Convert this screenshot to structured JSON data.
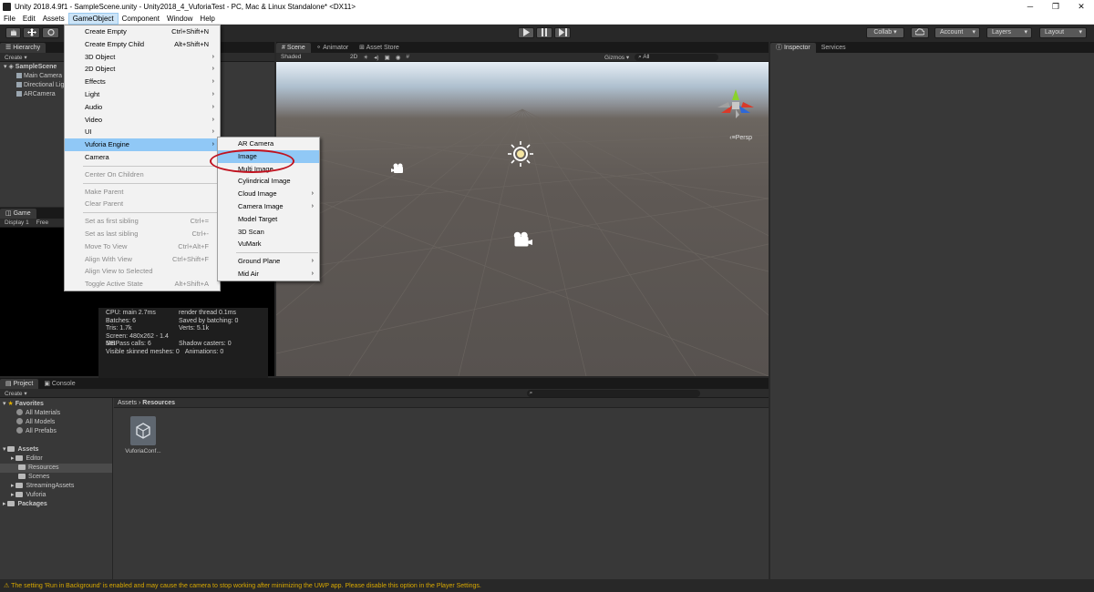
{
  "window": {
    "title": "Unity 2018.4.9f1 - SampleScene.unity - Unity2018_4_VuforiaTest - PC, Mac & Linux Standalone* <DX11>",
    "controls": [
      "─",
      "❐",
      "✕"
    ]
  },
  "menubar": [
    "File",
    "Edit",
    "Assets",
    "GameObject",
    "Component",
    "Window",
    "Help"
  ],
  "toolbar": {
    "collab": "Collab ▾",
    "account": "Account",
    "layers": "Layers",
    "layout": "Layout"
  },
  "hierarchy": {
    "tab": "Hierarchy",
    "create": "Create ▾",
    "scene": "SampleScene",
    "items": [
      "Main Camera",
      "Directional Light",
      "ARCamera"
    ]
  },
  "game": {
    "tab": "Game",
    "display": "Display 1",
    "free": "Free",
    "stats": [
      [
        "CPU: main 2.7ms",
        "render thread 0.1ms"
      ],
      [
        "Batches: 6",
        "Saved by batching: 0"
      ],
      [
        "Tris: 1.7k",
        "Verts: 5.1k"
      ],
      [
        "Screen: 480x262 - 1.4 MB",
        ""
      ],
      [
        "SetPass calls: 6",
        "Shadow casters: 0"
      ],
      [
        "Visible skinned meshes: 0",
        "Animations: 0"
      ]
    ]
  },
  "scene": {
    "tabs": [
      "Scene",
      "Animator",
      "Asset Store"
    ],
    "shaded": "Shaded",
    "mode2d": "2D",
    "gizmos": "Gizmos ▾",
    "search": "All",
    "persp": "Persp"
  },
  "inspector": {
    "tabs": [
      "Inspector",
      "Services"
    ]
  },
  "project": {
    "tabs": [
      "Project",
      "Console"
    ],
    "create": "Create ▾",
    "favorites": "Favorites",
    "fav_items": [
      "All Materials",
      "All Models",
      "All Prefabs"
    ],
    "assets": "Assets",
    "asset_items": [
      "Editor",
      "Resources",
      "Scenes",
      "StreamingAssets",
      "Vuforia"
    ],
    "packages": "Packages",
    "breadcrumb": [
      "Assets",
      "Resources"
    ],
    "file": "VuforiaConf..."
  },
  "gameobject_menu": [
    {
      "label": "Create Empty",
      "shortcut": "Ctrl+Shift+N"
    },
    {
      "label": "Create Empty Child",
      "shortcut": "Alt+Shift+N"
    },
    {
      "label": "3D Object",
      "submenu": true
    },
    {
      "label": "2D Object",
      "submenu": true
    },
    {
      "label": "Effects",
      "submenu": true
    },
    {
      "label": "Light",
      "submenu": true
    },
    {
      "label": "Audio",
      "submenu": true
    },
    {
      "label": "Video",
      "submenu": true
    },
    {
      "label": "UI",
      "submenu": true
    },
    {
      "label": "Vuforia Engine",
      "submenu": true,
      "highlighted": true
    },
    {
      "label": "Camera"
    },
    {
      "sep": true
    },
    {
      "label": "Center On Children",
      "disabled": true
    },
    {
      "sep": true
    },
    {
      "label": "Make Parent",
      "disabled": true
    },
    {
      "label": "Clear Parent",
      "disabled": true
    },
    {
      "sep": true
    },
    {
      "label": "Set as first sibling",
      "shortcut": "Ctrl+=",
      "disabled": true
    },
    {
      "label": "Set as last sibling",
      "shortcut": "Ctrl+-",
      "disabled": true
    },
    {
      "label": "Move To View",
      "shortcut": "Ctrl+Alt+F",
      "disabled": true
    },
    {
      "label": "Align With View",
      "shortcut": "Ctrl+Shift+F",
      "disabled": true
    },
    {
      "label": "Align View to Selected",
      "disabled": true
    },
    {
      "label": "Toggle Active State",
      "shortcut": "Alt+Shift+A",
      "disabled": true
    }
  ],
  "vuforia_menu": [
    {
      "label": "AR Camera"
    },
    {
      "label": "Image",
      "highlighted": true
    },
    {
      "label": "Multi Image"
    },
    {
      "label": "Cylindrical Image"
    },
    {
      "label": "Cloud Image",
      "submenu": true
    },
    {
      "label": "Camera Image",
      "submenu": true
    },
    {
      "label": "Model Target"
    },
    {
      "label": "3D Scan"
    },
    {
      "label": "VuMark"
    },
    {
      "sep": true
    },
    {
      "label": "Ground Plane",
      "submenu": true
    },
    {
      "label": "Mid Air",
      "submenu": true
    }
  ],
  "status": "The setting 'Run in Background' is enabled and may cause the camera to stop working after minimizing the UWP app. Please disable this option in the Player Settings."
}
